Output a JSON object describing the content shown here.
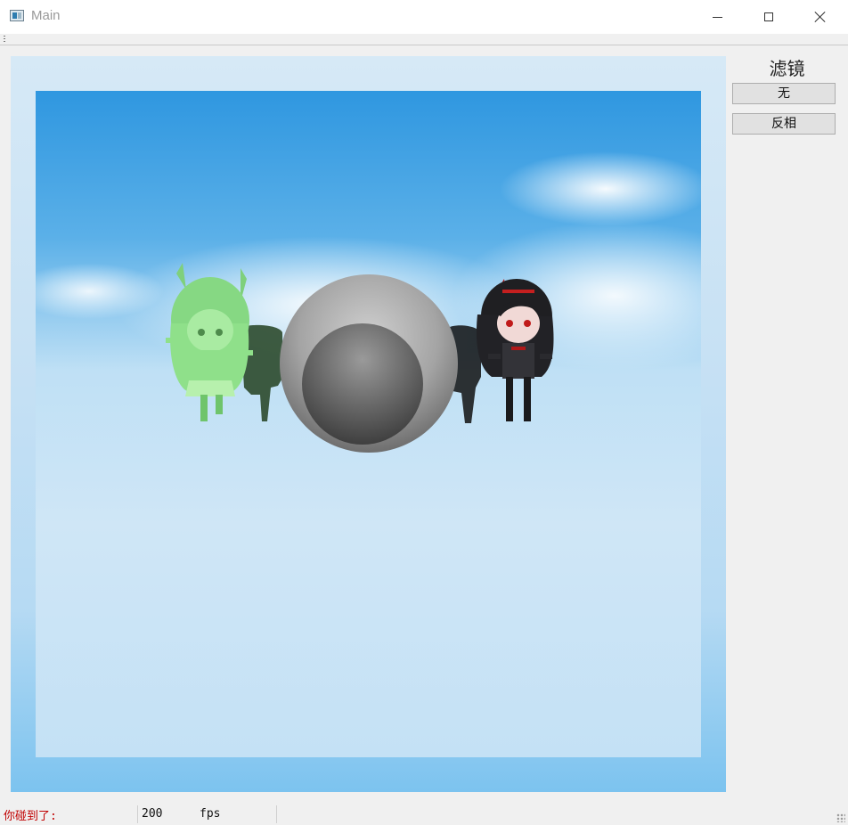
{
  "window": {
    "title": "Main",
    "controls": {
      "minimize_icon": "minimize-icon",
      "maximize_icon": "maximize-icon",
      "close_icon": "close-icon"
    }
  },
  "scene": {
    "objects": [
      "green chibi character",
      "gray sphere",
      "dark chibi character"
    ],
    "colors": {
      "sky": "#5bb0e8",
      "character_left": "#8fe08a",
      "sphere": "#9a9a9a",
      "character_right": "#2a2a2e"
    }
  },
  "side_panel": {
    "title": "滤镜",
    "buttons": [
      {
        "label": "无"
      },
      {
        "label": "反相"
      }
    ]
  },
  "status_bar": {
    "collision_label": "你碰到了:",
    "fps_value": "200",
    "fps_unit": "fps",
    "collision_color": "#c00000"
  }
}
